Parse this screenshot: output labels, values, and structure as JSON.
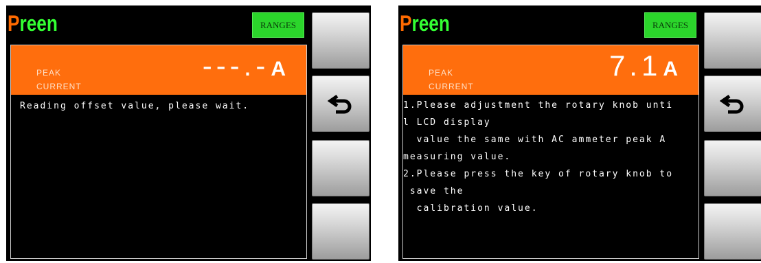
{
  "brand": {
    "first_letter": "P",
    "rest": "reen"
  },
  "ranges_label": "RANGES",
  "screens": [
    {
      "label_line1": "PEAK",
      "label_line2": "CURRENT",
      "value": "---.-",
      "unit": "A",
      "message": "Reading offset value, please wait."
    },
    {
      "label_line1": "PEAK",
      "label_line2": "CURRENT",
      "value": "7.1",
      "unit": "A",
      "message": "1.Please adjustment the rotary knob unti\nl LCD display\n  value the same with AC ammeter peak A\nmeasuring value.\n2.Please press the key of rotary knob to\n save the\n  calibration value."
    }
  ],
  "icons": {
    "back_button": "return-arrow-icon"
  },
  "colors": {
    "value_bar": "#ff6e0d",
    "ranges_button": "#2bd52b",
    "brand_first": "#ff6a00",
    "brand_rest": "#33ff33"
  }
}
